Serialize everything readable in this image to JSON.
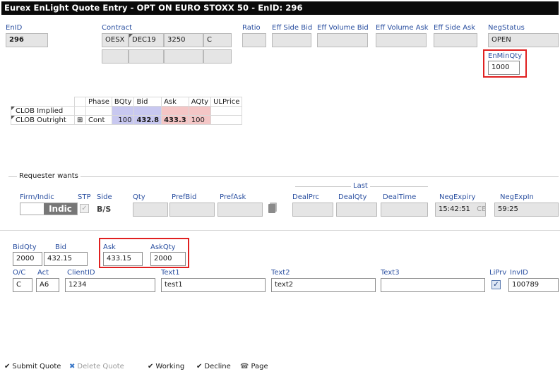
{
  "window": {
    "title": "Eurex EnLight Quote Entry - OPT ON EURO STOXX 50 - EnID: 296"
  },
  "header": {
    "enid_label": "EnID",
    "enid_value": "296",
    "contract_label": "Contract",
    "contract": [
      "OESX",
      "DEC19",
      "3250",
      "C"
    ],
    "ratio_label": "Ratio",
    "eff_side_bid_label": "Eff Side Bid",
    "eff_vol_bid_label": "Eff Volume Bid",
    "eff_vol_ask_label": "Eff Volume Ask",
    "eff_side_ask_label": "Eff Side Ask",
    "negstatus_label": "NegStatus",
    "negstatus_value": "OPEN",
    "enminqty_label": "EnMinQty",
    "enminqty_value": "1000"
  },
  "grid": {
    "headers": [
      "Phase",
      "BQty",
      "Bid",
      "Ask",
      "AQty",
      "ULPrice"
    ],
    "rows": [
      {
        "name": "CLOB Implied",
        "phase": "",
        "bqty": "",
        "bid": "",
        "ask": "",
        "aqty": "",
        "ul": ""
      },
      {
        "name": "CLOB Outright",
        "expand": "⊞",
        "phase": "Cont",
        "bqty": "100",
        "bid": "432.8",
        "ask": "433.3",
        "aqty": "100",
        "ul": ""
      }
    ]
  },
  "requester": {
    "section_label": "Requester wants",
    "last_label": "Last",
    "firm_label": "Firm/Indic",
    "firm_value": "Indic",
    "stp_label": "STP",
    "side_label": "Side",
    "side_value": "B/S",
    "qty_label": "Qty",
    "prefbid_label": "PrefBid",
    "prefask_label": "PrefAsk",
    "dealprc_label": "DealPrc",
    "dealqty_label": "DealQty",
    "dealtime_label": "DealTime",
    "negexpiry_label": "NegExpiry",
    "negexpiry_value": "15:42:51",
    "negexpiry_tz": "CEST",
    "negexpin_label": "NegExpIn",
    "negexpin_value": "59:25"
  },
  "quote": {
    "bidqty_label": "BidQty",
    "bidqty_value": "2000",
    "bid_label": "Bid",
    "bid_value": "432.15",
    "ask_label": "Ask",
    "ask_value": "433.15",
    "askqty_label": "AskQty",
    "askqty_value": "2000",
    "oc_label": "O/C",
    "oc_value": "C",
    "act_label": "Act",
    "act_value": "A6",
    "clientid_label": "ClientID",
    "clientid_value": "1234",
    "text1_label": "Text1",
    "text1_value": "test1",
    "text2_label": "Text2",
    "text2_value": "text2",
    "text3_label": "Text3",
    "text3_value": "",
    "liprv_label": "LiPrv",
    "invid_label": "InvID",
    "invid_value": "100789"
  },
  "toolbar": {
    "submit": "Submit Quote",
    "delete": "Delete Quote",
    "working": "Working",
    "decline": "Decline",
    "page": "Page"
  },
  "colors": {
    "title_bg": "#0a0a0a",
    "label": "#2a4fa0",
    "bid_bg": "#c8c8f0",
    "ask_bg": "#f4c6c6",
    "highlight": "#e02020"
  }
}
